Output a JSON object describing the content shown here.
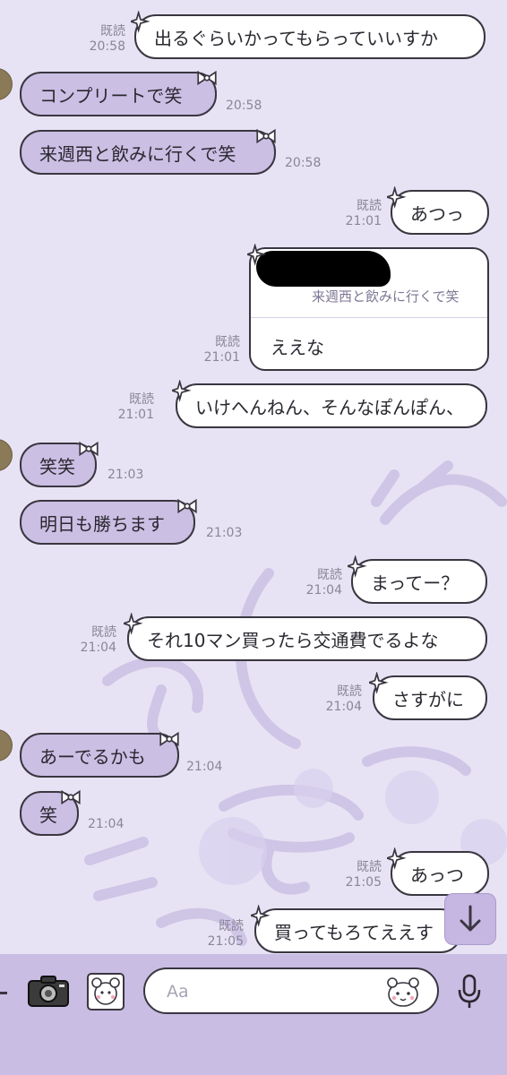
{
  "read_label": "既読",
  "messages": [
    {
      "side": "out",
      "text": "出るぐらいかってもらっていいすか",
      "time": "20:58",
      "read": true
    },
    {
      "side": "in",
      "text": "コンプリートで笑",
      "time": "20:58"
    },
    {
      "side": "in",
      "text": "来週西と飲みに行くで笑",
      "time": "20:58"
    },
    {
      "side": "out",
      "text": "あつっ",
      "time": "21:01",
      "read": true
    },
    {
      "side": "out",
      "text": "ええな",
      "time": "21:01",
      "read": true,
      "quoted_text": "来週西と飲みに行くで笑"
    },
    {
      "side": "out",
      "text": "いけへんねん、そんなぽんぽん、",
      "time": "21:01",
      "read": true
    },
    {
      "side": "in",
      "text": "笑笑",
      "time": "21:03"
    },
    {
      "side": "in",
      "text": "明日も勝ちます",
      "time": "21:03"
    },
    {
      "side": "out",
      "text": "まってー？",
      "time": "21:04",
      "read": true
    },
    {
      "side": "out",
      "text": "それ10マン買ったら交通費でるよな",
      "time": "21:04",
      "read": true
    },
    {
      "side": "out",
      "text": "さすがに",
      "time": "21:04",
      "read": true
    },
    {
      "side": "in",
      "text": "あーでるかも",
      "time": "21:04"
    },
    {
      "side": "in",
      "text": "笑",
      "time": "21:04"
    },
    {
      "side": "out",
      "text": "あっつ",
      "time": "21:05",
      "read": true
    },
    {
      "side": "out",
      "text": "買ってもろてええす",
      "time": "21:05",
      "read": true
    }
  ],
  "composer": {
    "placeholder": "Aa"
  },
  "colors": {
    "background": "#e8e3f4",
    "incoming_bubble": "#cbbfe4",
    "outgoing_bubble": "#ffffff",
    "composer_bar": "#c9bde3"
  },
  "icons": [
    "camera-icon",
    "sticker-icon",
    "emoji-icon",
    "microphone-icon",
    "scroll-down-icon",
    "bow-decoration-icon",
    "sparkle-decoration-icon"
  ]
}
